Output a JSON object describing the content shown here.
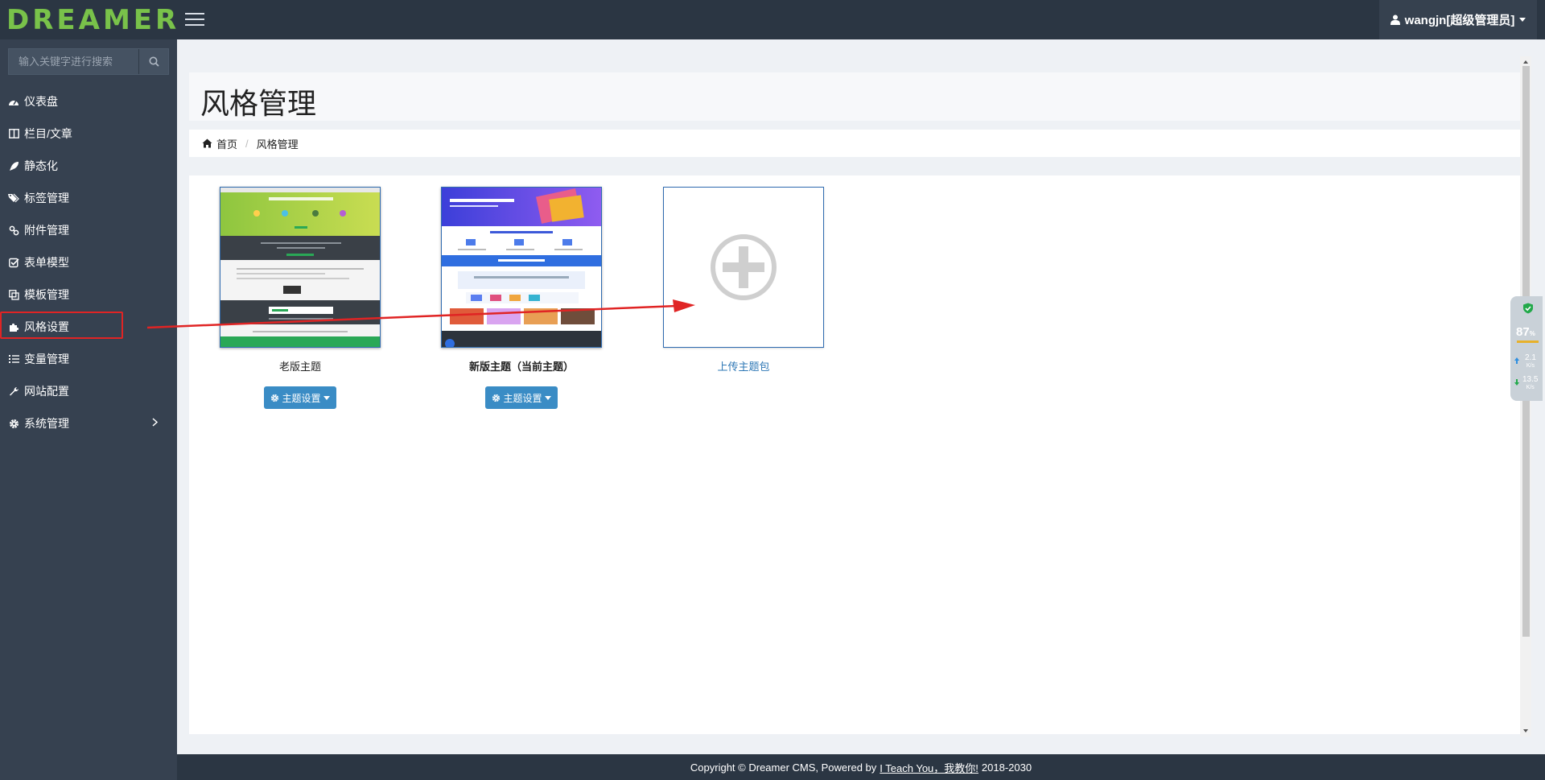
{
  "header": {
    "logo": "DREAMER",
    "user_label": "wangjn[超级管理员]"
  },
  "sidebar": {
    "search_placeholder": "输入关键字进行搜索",
    "items": [
      {
        "label": "仪表盘",
        "icon": "dashboard-icon"
      },
      {
        "label": "栏目/文章",
        "icon": "columns-icon"
      },
      {
        "label": "静态化",
        "icon": "rocket-icon"
      },
      {
        "label": "标签管理",
        "icon": "tags-icon"
      },
      {
        "label": "附件管理",
        "icon": "paperclip-icon"
      },
      {
        "label": "表单模型",
        "icon": "checkbox-icon"
      },
      {
        "label": "模板管理",
        "icon": "copy-icon"
      },
      {
        "label": "风格设置",
        "icon": "puzzle-icon",
        "highlighted": true
      },
      {
        "label": "变量管理",
        "icon": "list-icon"
      },
      {
        "label": "网站配置",
        "icon": "wrench-icon"
      },
      {
        "label": "系统管理",
        "icon": "gear-icon",
        "has_submenu": true
      }
    ]
  },
  "page": {
    "title": "风格管理",
    "breadcrumb": [
      "首页",
      "风格管理"
    ]
  },
  "themes": [
    {
      "name": "老版主题",
      "button": "主题设置"
    },
    {
      "name": "新版主题（当前主题）",
      "button": "主题设置"
    }
  ],
  "upload": {
    "label": "上传主题包"
  },
  "monitor": {
    "percent": "87",
    "unit": "%",
    "up": "2.1",
    "down": "13.5",
    "rate_unit": "K/s"
  },
  "footer": {
    "prefix": "Copyright © Dreamer CMS, Powered by",
    "link": "I Teach You，我教你!",
    "suffix": "2018-2030"
  },
  "colors": {
    "topbar": "#2b3643",
    "sidebar": "#364150",
    "button": "#3a8cc5",
    "annotation": "#e02424",
    "logo": "#79c24a"
  }
}
